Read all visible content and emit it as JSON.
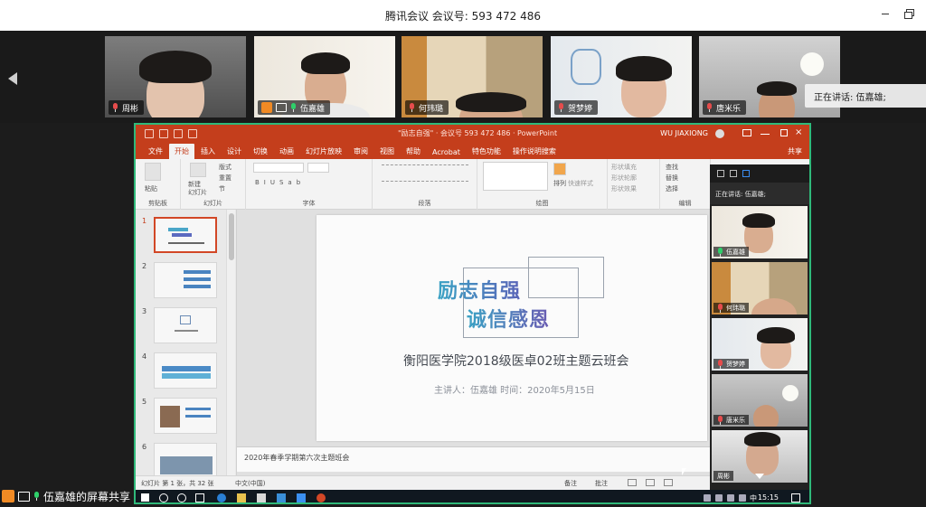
{
  "window": {
    "title": "腾讯会议 会议号: 593 472 486"
  },
  "participants": [
    {
      "name": "周彬"
    },
    {
      "name": "伍嘉雄"
    },
    {
      "name": "何玮璐"
    },
    {
      "name": "贺梦婷"
    },
    {
      "name": "唐米乐"
    }
  ],
  "speaking": {
    "label": "正在讲话: 伍嘉雄;"
  },
  "ppt": {
    "doc_title": "\"励志自强\" · 会议号 593 472 486 · PowerPoint",
    "user": "WU JIAXIONG",
    "tabs": [
      "文件",
      "开始",
      "插入",
      "设计",
      "切换",
      "动画",
      "幻灯片放映",
      "审阅",
      "视图",
      "帮助",
      "Acrobat",
      "特色功能",
      "操作说明搜索"
    ],
    "share_label": "共享",
    "groups": [
      "剪贴板",
      "幻灯片",
      "字体",
      "段落",
      "绘图",
      "编辑"
    ],
    "ribbon_items": {
      "paste": "粘贴",
      "new_slide": "新建\n幻灯片",
      "layout": "版式",
      "reset": "重置",
      "section": "节",
      "arrange": "排列",
      "quick_styles": "快速样式",
      "shape_fill": "形状填充",
      "shape_outline": "形状轮廓",
      "shape_effects": "形状效果",
      "find": "查找",
      "replace": "替换",
      "select": "选择"
    },
    "thumbnails": [
      "1",
      "2",
      "3",
      "4",
      "5",
      "6"
    ],
    "slide": {
      "motto_line1": "励志自强",
      "motto_line2": "诚信感恩",
      "headline": "衡阳医学院2018级医卓02班主题云班会",
      "subtitle": "主讲人：伍嘉雄    时间：2020年5月15日"
    },
    "notes": "2020年春季学期第六次主题班会",
    "status": {
      "slide_count": "幻灯片 第 1 张，共 32 张",
      "language": "中文(中国)",
      "notes_btn": "备注",
      "comments_btn": "批注"
    }
  },
  "taskbar": {
    "clock": "15:15",
    "ime": "中"
  },
  "side_panel": {
    "speaking": "正在讲话: 伍嘉雄;",
    "tiles": [
      "伍嘉雄",
      "何玮璐",
      "贺梦婷",
      "唐米乐",
      "周彬"
    ]
  },
  "share_label": {
    "text": "伍嘉雄的屏幕共享"
  }
}
